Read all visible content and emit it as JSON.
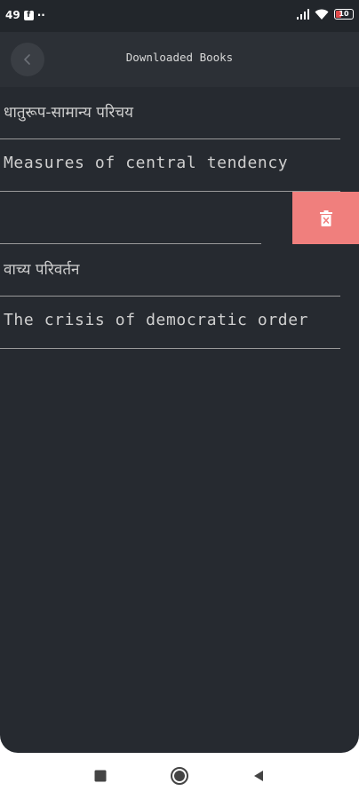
{
  "status_bar": {
    "time": "49",
    "notification_icon": "facebook-icon",
    "more_indicator": "··",
    "signal_icon": "cell-signal-icon",
    "wifi_icon": "wifi-icon",
    "battery_level": "10",
    "battery_color": "#e14b4b"
  },
  "app_bar": {
    "title": "Downloaded Books",
    "back_icon": "chevron-left-icon"
  },
  "books": [
    {
      "title": "धातुरूप-सामान्य परिचय"
    },
    {
      "title": "Measures of central tendency"
    },
    {
      "title": ""
    },
    {
      "title": "वाच्य परिवर्तन"
    },
    {
      "title": "The crisis of democratic order"
    }
  ],
  "swipe_action": {
    "icon": "trash-icon",
    "color": "#f07f7d"
  },
  "nav_bar": {
    "recents_icon": "square-icon",
    "home_icon": "circle-icon",
    "back_icon": "triangle-back-icon"
  },
  "colors": {
    "background": "#262a30",
    "app_bar": "#2c3036",
    "text": "#cfcfcf",
    "divider": "#9a9a9a"
  }
}
